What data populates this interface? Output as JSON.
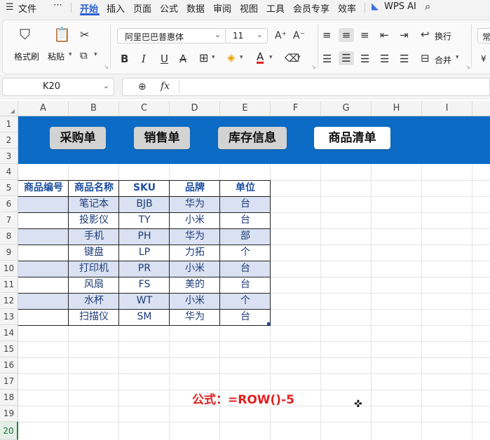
{
  "menu": {
    "file": "文件",
    "more": "⋯",
    "tabs": [
      "开始",
      "插入",
      "页面",
      "公式",
      "数据",
      "审阅",
      "视图",
      "工具",
      "会员专享",
      "效率"
    ],
    "active_tab": "开始",
    "wps_ai": "WPS AI"
  },
  "ribbon": {
    "format_painter": "格式刷",
    "paste": "粘贴",
    "font_name": "阿里巴巴普惠体",
    "font_size": "11",
    "wrap_text": "换行",
    "merge": "合并",
    "partial_style": "常",
    "partial_currency": "¥"
  },
  "formula_bar": {
    "name_box": "K20",
    "fx": "fx",
    "content": ""
  },
  "columns": [
    "A",
    "B",
    "C",
    "D",
    "E",
    "F",
    "G",
    "H",
    "I"
  ],
  "rows": [
    "1",
    "2",
    "3",
    "4",
    "5",
    "6",
    "7",
    "8",
    "9",
    "10",
    "11",
    "12",
    "13",
    "14",
    "15",
    "16",
    "17",
    "18",
    "19",
    "20"
  ],
  "nav_buttons": [
    "采购单",
    "销售单",
    "库存信息",
    "商品清单"
  ],
  "table": {
    "headers": [
      "商品编号",
      "商品名称",
      "SKU",
      "品牌",
      "单位"
    ],
    "rows": [
      [
        "",
        "笔记本",
        "BJB",
        "华为",
        "台"
      ],
      [
        "",
        "投影仪",
        "TY",
        "小米",
        "台"
      ],
      [
        "",
        "手机",
        "PH",
        "华为",
        "部"
      ],
      [
        "",
        "键盘",
        "LP",
        "力拓",
        "个"
      ],
      [
        "",
        "打印机",
        "PR",
        "小米",
        "台"
      ],
      [
        "",
        "风扇",
        "FS",
        "美的",
        "台"
      ],
      [
        "",
        "水杯",
        "WT",
        "小米",
        "个"
      ],
      [
        "",
        "扫描仪",
        "SM",
        "华为",
        "台"
      ]
    ]
  },
  "annotation": "公式：=ROW()-5",
  "colors": {
    "banner": "#0b6bc5",
    "accent": "#2a62d8",
    "band": "#d9e1f2",
    "header_text": "#1e4fa0",
    "annotation": "#e02020"
  }
}
